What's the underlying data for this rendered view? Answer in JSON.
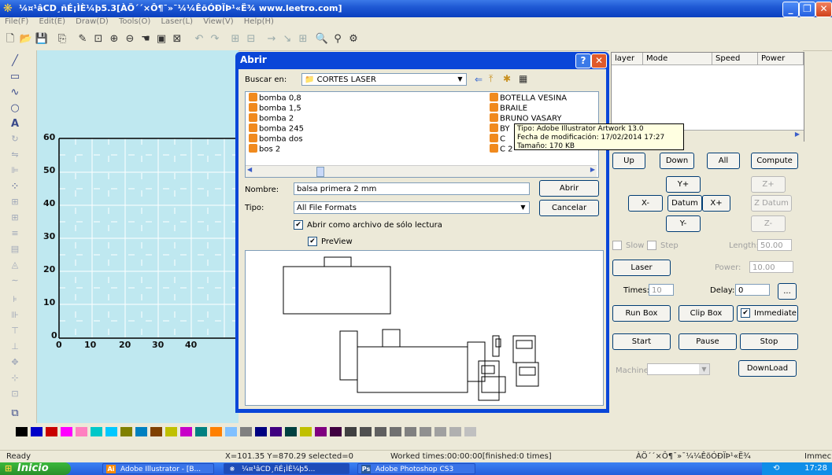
{
  "window": {
    "title": "¼¤¹âCD¸ñÉ¡ÌÈ¼þ5.3[ÀÖ´´×Ô¶¯»¯¼¼ÊõÓÐÏÞ¹«Ë¾ www.leetro.com]",
    "menu": [
      "File(F)",
      "Edit(E)",
      "Draw(D)",
      "Tools(O)",
      "Laser(L)",
      "View(V)",
      "Help(H)"
    ]
  },
  "canvas": {
    "y_labels": [
      "60",
      "50",
      "40",
      "30",
      "20",
      "10",
      "0"
    ],
    "x_labels": [
      "0",
      "10",
      "20",
      "30",
      "40"
    ]
  },
  "dialog": {
    "title": "Abrir",
    "lookin_label": "Buscar en:",
    "lookin_value": "CORTES LASER",
    "files_left": [
      "bomba 0,8",
      "bomba 1,5",
      "bomba 2",
      "bomba 245",
      "bomba dos",
      "bos 2"
    ],
    "files_right": [
      "BOTELLA VESINA",
      "BRAILE",
      "BRUNO VASARY",
      "BY",
      "C",
      "C 2"
    ],
    "tooltip": {
      "line1": "Tipo: Adobe Illustrator Artwork 13.0",
      "line2": "Fecha de modificación: 17/02/2014 17:27",
      "line3": "Tamaño: 170 KB"
    },
    "name_label": "Nombre:",
    "name_value": "balsa primera 2 mm",
    "type_label": "Tipo:",
    "type_value": "All File Formats",
    "open_button": "Abrir",
    "cancel_button": "Cancelar",
    "readonly_label": "Abrir como archivo de sólo lectura",
    "preview_label": "PreView"
  },
  "right_panel": {
    "columns": [
      "layer",
      "Mode",
      "Speed",
      "Power"
    ],
    "up": "Up",
    "down": "Down",
    "all": "All",
    "compute": "Compute",
    "yplus": "Y+",
    "zplus": "Z+",
    "xminus": "X-",
    "datum": "Datum",
    "xplus": "X+",
    "zdatum": "Z Datum",
    "yminus": "Y-",
    "zminus": "Z-",
    "slow": "Slow",
    "step": "Step",
    "length_label": "Length:",
    "length_value": "50.00",
    "laser": "Laser",
    "power_label": "Power:",
    "power_value": "10.00",
    "times_label": "Times:",
    "times_value": "10",
    "delay_label": "Delay:",
    "delay_value": "0",
    "more": "...",
    "runbox": "Run Box",
    "clipbox": "Clip Box",
    "immediate": "Immediate",
    "start": "Start",
    "pause": "Pause",
    "stop": "Stop",
    "machine_label": "Machine:",
    "download": "DownLoad"
  },
  "palette": [
    "#000000",
    "#0000c8",
    "#c80000",
    "#ff00ff",
    "#ff80c0",
    "#00c8c8",
    "#00c8ff",
    "#808000",
    "#0080c0",
    "#804000",
    "#c0c000",
    "#c800c8",
    "#008080",
    "#ff8000",
    "#80c0ff",
    "#808080",
    "#000080",
    "#400080",
    "#004040",
    "#c0c000",
    "#800080",
    "#400040",
    "#404040",
    "#505050",
    "#606060",
    "#707070",
    "#808080",
    "#909090",
    "#a0a0a0",
    "#b0b0b0",
    "#c0c0c0"
  ],
  "status": {
    "ready": "Ready",
    "coords": "X=101.35 Y=870.29 selected=0",
    "worked": "Worked times:00:00:00[finished:0 times]",
    "company": "ÀÖ´´×Ô¶¯»¯¼¼ÊõÓÐÏÞ¹«Ë¾",
    "immed": "Immec"
  },
  "taskbar": {
    "start": "Inicio",
    "tasks": [
      "Adobe Illustrator - [B...",
      "¼¤¹âCD¸ñÉ¡ÌÈ¼þ5...",
      "Adobe Photoshop CS3"
    ],
    "time": "17:28"
  }
}
